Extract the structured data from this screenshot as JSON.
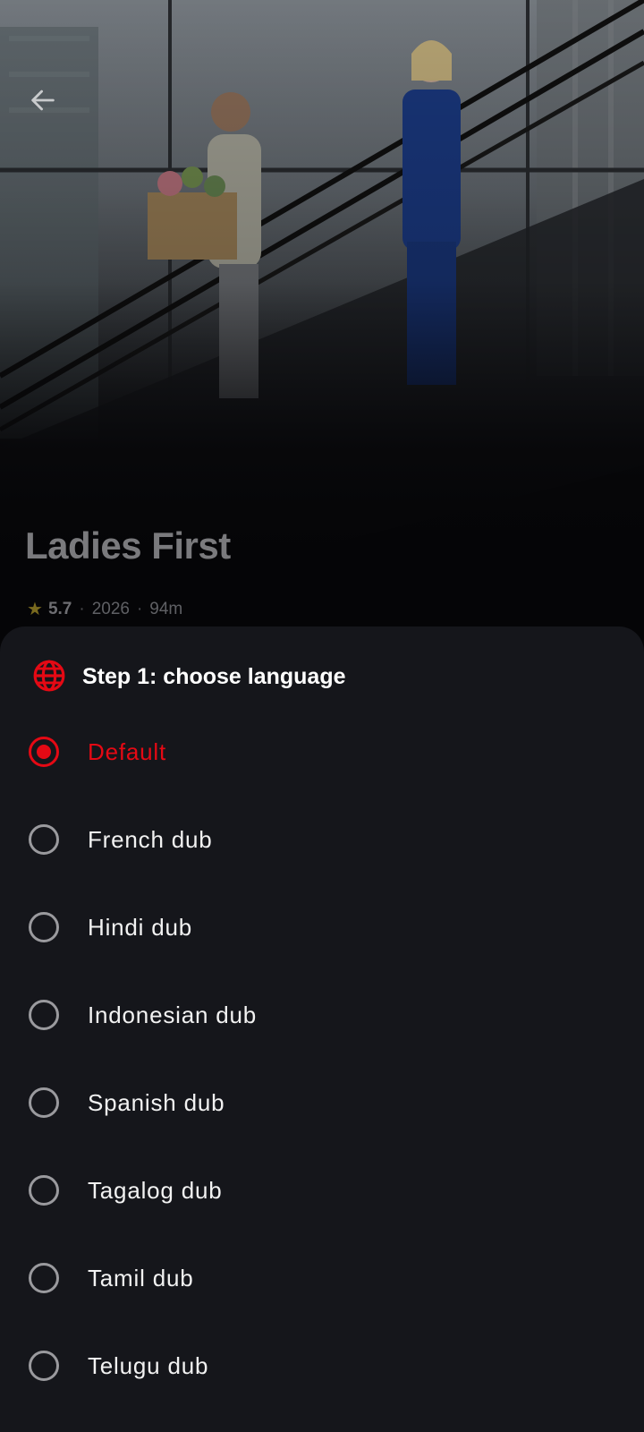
{
  "header": {
    "back_icon": "arrow-left-icon"
  },
  "movie": {
    "title": "Ladies First",
    "rating": "5.7",
    "year": "2026",
    "duration": "94m",
    "separator": "·",
    "star_icon": "star-icon"
  },
  "sheet": {
    "title": "Step 1: choose language",
    "icon": "globe-icon",
    "selected_index": 0,
    "options": [
      {
        "label": "Default",
        "selected": true
      },
      {
        "label": "French dub",
        "selected": false
      },
      {
        "label": "Hindi dub",
        "selected": false
      },
      {
        "label": "Indonesian dub",
        "selected": false
      },
      {
        "label": "Spanish dub",
        "selected": false
      },
      {
        "label": "Tagalog dub",
        "selected": false
      },
      {
        "label": "Tamil dub",
        "selected": false
      },
      {
        "label": "Telugu dub",
        "selected": false
      }
    ]
  },
  "colors": {
    "accent": "#e50914",
    "sheet_background": "#15161b",
    "page_background": "#050507"
  }
}
